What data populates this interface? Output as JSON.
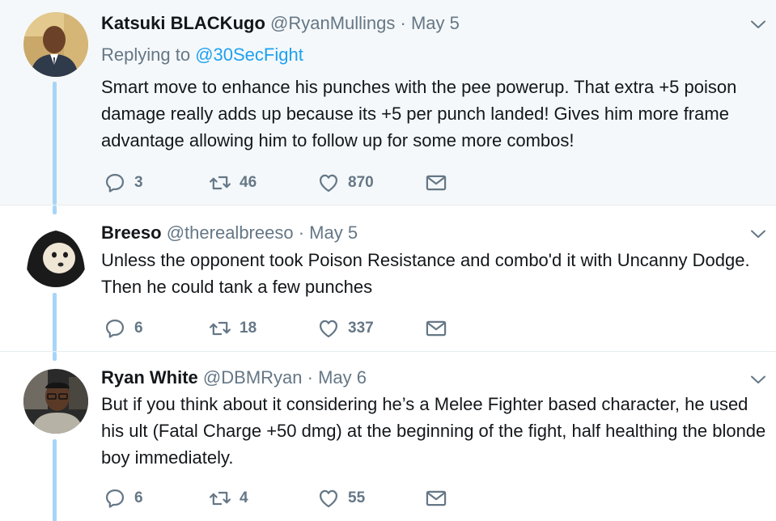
{
  "tweets": [
    {
      "name": "Katsuki BLACKugo",
      "handle": "@RyanMullings",
      "date": "May 5",
      "replying_label": "Replying to",
      "replying_to": "@30SecFight",
      "text": "Smart move to enhance his punches with the pee powerup. That extra +5 poison damage really adds up because its +5 per punch landed! Gives him more frame advantage allowing him to follow up for some more combos!",
      "replies": "3",
      "retweets": "46",
      "likes": "870"
    },
    {
      "name": "Breeso",
      "handle": "@therealbreeso",
      "date": "May 5",
      "text": "Unless the opponent took Poison Resistance and combo'd it with Uncanny Dodge. Then he could tank a few punches",
      "replies": "6",
      "retweets": "18",
      "likes": "337"
    },
    {
      "name": "Ryan White",
      "handle": "@DBMRyan",
      "date": "May 6",
      "text": "But if you think about it considering he’s a Melee Fighter based character, he used his ult (Fatal Charge +50 dmg) at the beginning of the fight, half healthing the blonde boy immediately.",
      "replies": "6",
      "retweets": "4",
      "likes": "55"
    }
  ],
  "separator": "·",
  "colors": {
    "highlight_bg": "#f5f8fa",
    "accent": "#1da1f2",
    "thread_line": "#a7d5f7",
    "muted": "#657786"
  },
  "icons": [
    "reply-icon",
    "retweet-icon",
    "like-icon",
    "message-icon",
    "chevron-down-icon"
  ]
}
